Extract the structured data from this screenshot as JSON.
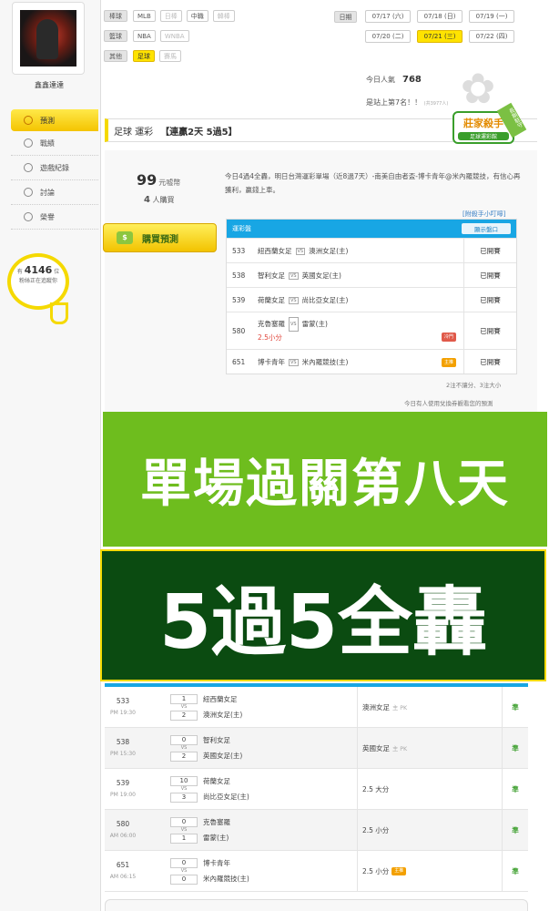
{
  "user": {
    "name": "鑫鑫達達"
  },
  "menu": [
    {
      "label": "預測",
      "icon": "target-icon",
      "active": true
    },
    {
      "label": "戰績",
      "icon": "chat-icon"
    },
    {
      "label": "遊戲紀錄",
      "icon": "record-icon"
    },
    {
      "label": "討論",
      "icon": "edit-icon"
    },
    {
      "label": "榮譽",
      "icon": "trophy-icon"
    }
  ],
  "watchers": {
    "prefix": "有",
    "count": "4146",
    "suffix": "位",
    "line2": "粉絲正在追蹤你"
  },
  "filters": {
    "baseball": {
      "label": "棒球",
      "options": [
        "MLB",
        "日棒",
        "中職",
        "韓棒"
      ]
    },
    "basketball": {
      "label": "籃球",
      "options": [
        "NBA",
        "WNBA"
      ]
    },
    "other": {
      "label": "其他",
      "options": [
        "足球",
        "賽馬"
      ]
    }
  },
  "dates": {
    "label": "日期",
    "items": [
      "07/17 (六)",
      "07/18 (日)",
      "07/19 (一)",
      "07/20 (二)",
      "07/21 (三)",
      "07/22 (四)"
    ],
    "selected": "07/21 (三)"
  },
  "popularity": {
    "label": "今日人氣",
    "value": "768"
  },
  "rank": {
    "text": "是站上第7名！！",
    "note": "(共3977人)"
  },
  "title": {
    "sport": "足球 運彩",
    "streak": "【連贏2天 5過5】"
  },
  "badge": {
    "title": "莊家殺手",
    "subtitle": "足球運彩館",
    "ribbon": "長期駐守"
  },
  "price": {
    "value": "99",
    "unit": "元嘘幣"
  },
  "buyers": {
    "count": "4",
    "unit": "人購買"
  },
  "description": "今日4過4全轟，明日台灣運彩單場（近8過7天）-南美自由者盃-博卡青年@米內羅競技，有信心再獲利，贏錢上車。",
  "helper_link": "[附殺手小叮嚀]",
  "buy_button": {
    "label": "購買預測"
  },
  "pick_table": {
    "header": "運彩盤",
    "show_btn": "顯示盤口",
    "rows": [
      {
        "no": "533",
        "home": "紐西蘭女足",
        "away": "澳洲女足(主)",
        "status": "已開賽"
      },
      {
        "no": "538",
        "home": "智利女足",
        "away": "英國女足(主)",
        "status": "已開賽"
      },
      {
        "no": "539",
        "home": "荷蘭女足",
        "away": "尚比亞女足(主)",
        "status": "已開賽"
      },
      {
        "no": "580",
        "home": "克魯塞羅",
        "away": "雷蒙(主)",
        "pick": "2.5小分",
        "tag": "冷門",
        "status": "已開賽"
      },
      {
        "no": "651",
        "home": "博卡青年",
        "away": "米內羅競技(主)",
        "tag": "主推",
        "status": "已開賽"
      }
    ]
  },
  "vs_text": "VS",
  "footnote1": "2注不讓分、3注大小",
  "footnote2": "今日有人使用兌換券觀看您的預測",
  "banner1": "單場過關第八天",
  "banner2": "5過5全轟",
  "results": [
    {
      "no": "533",
      "time": "PM 19:30",
      "s1": "1",
      "s2": "2",
      "home": "紐西蘭女足",
      "away": "澳洲女足(主)",
      "pick": "澳洲女足",
      "pick_note": "主 PK",
      "hit": "準"
    },
    {
      "no": "538",
      "time": "PM 15:30",
      "s1": "0",
      "s2": "2",
      "home": "智利女足",
      "away": "英國女足(主)",
      "pick": "英國女足",
      "pick_note": "主 PK",
      "hit": "準"
    },
    {
      "no": "539",
      "time": "PM 19:00",
      "s1": "10",
      "s2": "3",
      "home": "荷蘭女足",
      "away": "尚比亞女足(主)",
      "pick": "2.5 大分",
      "pick_note": "",
      "hit": "準"
    },
    {
      "no": "580",
      "time": "AM 06:00",
      "s1": "0",
      "s2": "1",
      "home": "克魯塞羅",
      "away": "雷蒙(主)",
      "pick": "2.5 小分",
      "pick_note": "",
      "hit": "準"
    },
    {
      "no": "651",
      "time": "AM 06:15",
      "s1": "0",
      "s2": "0",
      "home": "博卡青年",
      "away": "米內羅競技(主)",
      "pick": "2.5 小分",
      "pick_note": "",
      "tag": "主推",
      "hit": "準"
    }
  ],
  "colors": {
    "accent_yellow": "#ffe300",
    "blue": "#18a6e4",
    "green": "#6ebd1e",
    "dark_green": "#0b4b11"
  }
}
